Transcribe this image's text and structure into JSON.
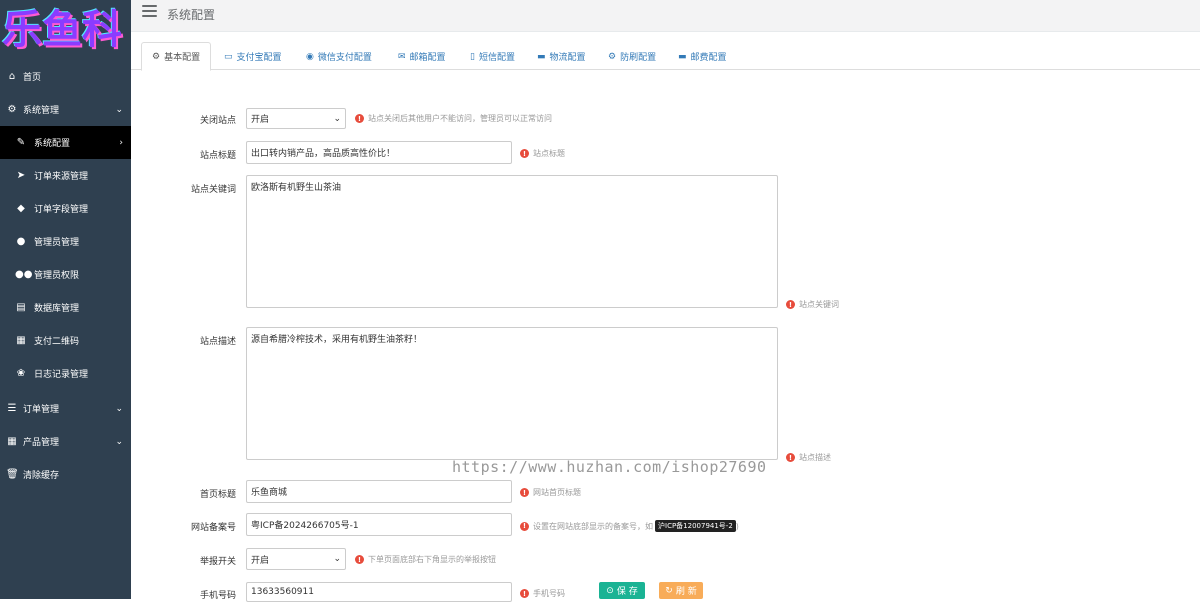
{
  "logo": {
    "text": "乐鱼科"
  },
  "header": {
    "title": "系统配置"
  },
  "sidebar": {
    "items": [
      {
        "label": "首页",
        "icon": "home-icon"
      },
      {
        "label": "系统管理",
        "icon": "gear-icon"
      },
      {
        "label": "系统配置",
        "icon": "wrench-icon"
      },
      {
        "label": "订单来源管理",
        "icon": "location-arrow-icon"
      },
      {
        "label": "订单字段管理",
        "icon": "tags-icon"
      },
      {
        "label": "管理员管理",
        "icon": "user-icon"
      },
      {
        "label": "管理员权限",
        "icon": "users-icon"
      },
      {
        "label": "数据库管理",
        "icon": "database-icon"
      },
      {
        "label": "支付二维码",
        "icon": "qrcode-icon"
      },
      {
        "label": "日志记录管理",
        "icon": "paw-icon"
      },
      {
        "label": "订单管理",
        "icon": "list-icon"
      },
      {
        "label": "产品管理",
        "icon": "grid-icon"
      },
      {
        "label": "清除缓存",
        "icon": "trash-icon"
      }
    ]
  },
  "tabs": [
    {
      "label": "基本配置",
      "icon": "cogs-icon"
    },
    {
      "label": "支付宝配置",
      "icon": "credit-card-icon"
    },
    {
      "label": "微信支付配置",
      "icon": "wechat-icon"
    },
    {
      "label": "邮箱配置",
      "icon": "envelope-icon"
    },
    {
      "label": "短信配置",
      "icon": "mobile-icon"
    },
    {
      "label": "物流配置",
      "icon": "truck-icon"
    },
    {
      "label": "防刷配置",
      "icon": "gear-icon"
    },
    {
      "label": "邮费配置",
      "icon": "truck-icon"
    }
  ],
  "form": {
    "close_site": {
      "label": "关闭站点",
      "value": "开启",
      "hint": "站点关闭后其他用户不能访问，管理员可以正常访问"
    },
    "site_title": {
      "label": "站点标题",
      "value": "出口转内销产品，高品质高性价比！",
      "hint": "站点标题"
    },
    "site_keywords": {
      "label": "站点关键词",
      "value": "欧洛斯有机野生山茶油",
      "hint": "站点关键词"
    },
    "site_desc": {
      "label": "站点描述",
      "value": "源自希腊冷榨技术，采用有机野生油茶籽！",
      "hint": "站点描述"
    },
    "home_title": {
      "label": "首页标题",
      "value": "乐鱼商城",
      "hint": "网站首页标题"
    },
    "icp": {
      "label": "网站备案号",
      "value": "粤ICP备2024266705号-1",
      "hint": "设置在网站底部显示的备案号，如",
      "example": "沪ICP备12007941号-2",
      "tail": ")"
    },
    "report_switch": {
      "label": "举报开关",
      "value": "开启",
      "hint": "下单页面底部右下角显示的举报按钮"
    },
    "phone": {
      "label": "手机号码",
      "value": "13633560911",
      "hint": "手机号码"
    }
  },
  "buttons": {
    "save": "保 存",
    "refresh": "刷 新"
  },
  "watermark": "https://www.huzhan.com/ishop27690",
  "colors": {
    "sidebar": "#2f4050",
    "active": "#000000",
    "save": "#1ab394",
    "refresh": "#f8ac59",
    "warn": "#e74c3c"
  }
}
